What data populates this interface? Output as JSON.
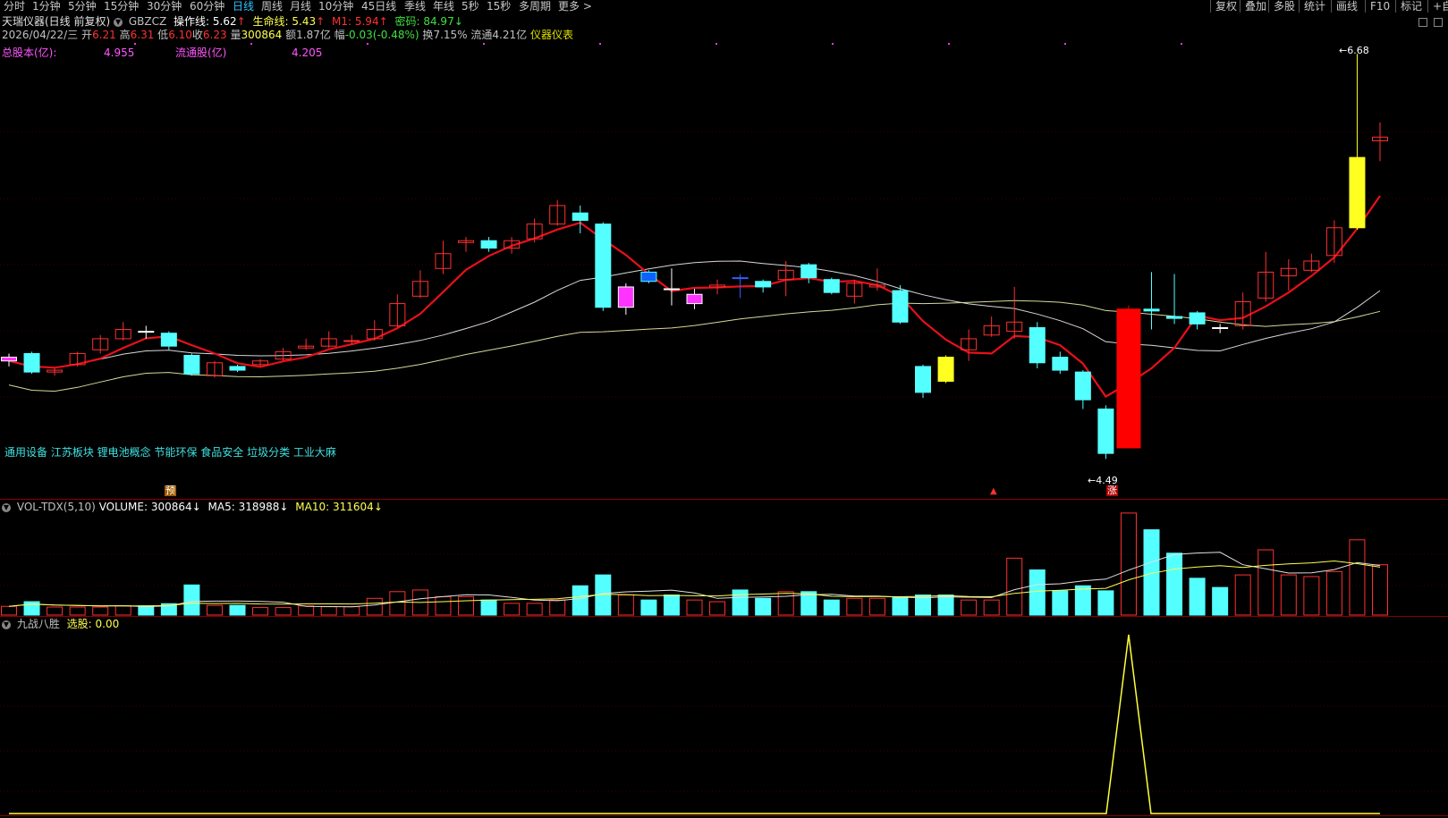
{
  "toolbar": {
    "periods": [
      "分时",
      "1分钟",
      "5分钟",
      "15分钟",
      "30分钟",
      "60分钟",
      "日线",
      "周线",
      "月线",
      "10分钟",
      "45日线",
      "季线",
      "年线",
      "5秒",
      "15秒",
      "多周期",
      "更多 >"
    ],
    "active": "日线",
    "right": [
      "复权",
      "叠加",
      "多股",
      "统计",
      "画线",
      "F10",
      "标记",
      "+自"
    ]
  },
  "header": {
    "name": "天瑞仪器(日线 前复权)",
    "indicator": "GBZCZ",
    "czx_label": "操作线:",
    "czx_value": "5.62",
    "smx_label": "生命线:",
    "smx_value": "5.43",
    "m1_label": "M1:",
    "m1_value": "5.94",
    "mm_label": "密码:",
    "mm_value": "84.97"
  },
  "quote": {
    "date": "2026/04/22/三",
    "open_label": "开",
    "open": "6.21",
    "high_label": "高",
    "high": "6.31",
    "low_label": "低",
    "low": "6.10",
    "close_label": "收",
    "close": "6.23",
    "vol_label": "量",
    "vol": "300864",
    "amt_label": "额",
    "amt": "1.87亿",
    "chg_label": "幅",
    "chg": "-0.03(-0.48%)",
    "turn_label": "换",
    "turn": "7.15%",
    "float_label": "流通",
    "float": "4.21亿",
    "industry": "仪器仪表"
  },
  "shares": {
    "total_label": "总股本(亿)",
    "total": "4.955",
    "float_label": "流通股(亿)",
    "float": "4.205"
  },
  "concepts": "通用设备 江苏板块 锂电池概念 节能环保 食品安全 垃圾分类 工业大麻",
  "markers": {
    "yu": "预",
    "zhang": "涨"
  },
  "price_labels": {
    "high": "6.68",
    "low": "4.49"
  },
  "volume_panel": {
    "name": "VOL-TDX(5,10)",
    "volume_label": "VOLUME:",
    "volume": "300864",
    "ma5_label": "MA5:",
    "ma5": "318988",
    "ma10_label": "MA10:",
    "ma10": "311604"
  },
  "signal_panel": {
    "name": "九战八胜",
    "label": "选股:",
    "value": "0.00"
  },
  "colors": {
    "up": "#ff3030",
    "down": "#54ffff",
    "red_line": "#e8101a",
    "white_line": "#d8d8d8",
    "yellow_line": "#d8d89a",
    "signal": "#ffff3a",
    "purple": "#ff33ff"
  },
  "chart_data": {
    "type": "candlestick",
    "candles": [
      {
        "o": 5.04,
        "c": 5.02,
        "h": 5.06,
        "l": 4.99,
        "dir": "flat-m"
      },
      {
        "o": 5.06,
        "c": 4.96,
        "h": 5.07,
        "l": 4.95,
        "dir": "down"
      },
      {
        "o": 4.96,
        "c": 4.97,
        "h": 4.98,
        "l": 4.94,
        "dir": "up"
      },
      {
        "o": 5.0,
        "c": 5.06,
        "h": 5.07,
        "l": 4.99,
        "dir": "up"
      },
      {
        "o": 5.08,
        "c": 5.14,
        "h": 5.16,
        "l": 5.06,
        "dir": "up"
      },
      {
        "o": 5.14,
        "c": 5.19,
        "h": 5.23,
        "l": 5.13,
        "dir": "up"
      },
      {
        "o": 5.18,
        "c": 5.18,
        "h": 5.21,
        "l": 5.14,
        "dir": "flat"
      },
      {
        "o": 5.17,
        "c": 5.1,
        "h": 5.18,
        "l": 5.08,
        "dir": "down"
      },
      {
        "o": 5.05,
        "c": 4.95,
        "h": 5.06,
        "l": 4.94,
        "dir": "down"
      },
      {
        "o": 4.94,
        "c": 5.01,
        "h": 5.02,
        "l": 4.93,
        "dir": "up"
      },
      {
        "o": 4.99,
        "c": 4.97,
        "h": 5.0,
        "l": 4.96,
        "dir": "down"
      },
      {
        "o": 5.0,
        "c": 5.02,
        "h": 5.03,
        "l": 4.99,
        "dir": "up"
      },
      {
        "o": 5.03,
        "c": 5.07,
        "h": 5.09,
        "l": 5.02,
        "dir": "up"
      },
      {
        "o": 5.09,
        "c": 5.1,
        "h": 5.14,
        "l": 5.08,
        "dir": "up"
      },
      {
        "o": 5.1,
        "c": 5.14,
        "h": 5.18,
        "l": 5.09,
        "dir": "up"
      },
      {
        "o": 5.13,
        "c": 5.13,
        "h": 5.16,
        "l": 5.11,
        "dir": "up"
      },
      {
        "o": 5.14,
        "c": 5.19,
        "h": 5.24,
        "l": 5.13,
        "dir": "up"
      },
      {
        "o": 5.21,
        "c": 5.33,
        "h": 5.38,
        "l": 5.2,
        "dir": "up"
      },
      {
        "o": 5.37,
        "c": 5.45,
        "h": 5.51,
        "l": 5.36,
        "dir": "up"
      },
      {
        "o": 5.52,
        "c": 5.6,
        "h": 5.67,
        "l": 5.49,
        "dir": "up"
      },
      {
        "o": 5.66,
        "c": 5.67,
        "h": 5.69,
        "l": 5.61,
        "dir": "up"
      },
      {
        "o": 5.67,
        "c": 5.63,
        "h": 5.69,
        "l": 5.61,
        "dir": "down"
      },
      {
        "o": 5.63,
        "c": 5.67,
        "h": 5.69,
        "l": 5.6,
        "dir": "up"
      },
      {
        "o": 5.68,
        "c": 5.76,
        "h": 5.79,
        "l": 5.66,
        "dir": "up"
      },
      {
        "o": 5.76,
        "c": 5.86,
        "h": 5.89,
        "l": 5.75,
        "dir": "up"
      },
      {
        "o": 5.82,
        "c": 5.78,
        "h": 5.86,
        "l": 5.71,
        "dir": "down"
      },
      {
        "o": 5.76,
        "c": 5.31,
        "h": 5.77,
        "l": 5.29,
        "dir": "down"
      },
      {
        "o": 5.31,
        "c": 5.42,
        "h": 5.44,
        "l": 5.27,
        "dir": "up-m"
      },
      {
        "o": 5.5,
        "c": 5.45,
        "h": 5.51,
        "l": 5.44,
        "dir": "down-b"
      },
      {
        "o": 5.41,
        "c": 5.41,
        "h": 5.52,
        "l": 5.32,
        "dir": "flat-w"
      },
      {
        "o": 5.33,
        "c": 5.38,
        "h": 5.41,
        "l": 5.3,
        "dir": "up-m"
      },
      {
        "o": 5.42,
        "c": 5.43,
        "h": 5.46,
        "l": 5.38,
        "dir": "up"
      },
      {
        "o": 5.47,
        "c": 5.47,
        "h": 5.49,
        "l": 5.36,
        "dir": "flat-b"
      },
      {
        "o": 5.45,
        "c": 5.42,
        "h": 5.46,
        "l": 5.39,
        "dir": "down"
      },
      {
        "o": 5.46,
        "c": 5.51,
        "h": 5.56,
        "l": 5.37,
        "dir": "up"
      },
      {
        "o": 5.54,
        "c": 5.47,
        "h": 5.55,
        "l": 5.44,
        "dir": "down"
      },
      {
        "o": 5.46,
        "c": 5.39,
        "h": 5.47,
        "l": 5.38,
        "dir": "down"
      },
      {
        "o": 5.37,
        "c": 5.44,
        "h": 5.46,
        "l": 5.33,
        "dir": "up"
      },
      {
        "o": 5.43,
        "c": 5.42,
        "h": 5.52,
        "l": 5.4,
        "dir": "up"
      },
      {
        "o": 5.4,
        "c": 5.23,
        "h": 5.43,
        "l": 5.22,
        "dir": "down"
      },
      {
        "o": 4.99,
        "c": 4.85,
        "h": 5.0,
        "l": 4.82,
        "dir": "down"
      },
      {
        "o": 4.91,
        "c": 5.04,
        "h": 5.05,
        "l": 4.9,
        "dir": "yellow"
      },
      {
        "o": 5.08,
        "c": 5.14,
        "h": 5.19,
        "l": 5.02,
        "dir": "up"
      },
      {
        "o": 5.16,
        "c": 5.21,
        "h": 5.26,
        "l": 5.15,
        "dir": "up"
      },
      {
        "o": 5.18,
        "c": 5.23,
        "h": 5.42,
        "l": 5.14,
        "dir": "up"
      },
      {
        "o": 5.2,
        "c": 5.01,
        "h": 5.23,
        "l": 4.98,
        "dir": "down"
      },
      {
        "o": 5.04,
        "c": 4.97,
        "h": 5.07,
        "l": 4.95,
        "dir": "down"
      },
      {
        "o": 4.96,
        "c": 4.81,
        "h": 4.97,
        "l": 4.76,
        "dir": "down"
      },
      {
        "o": 4.76,
        "c": 4.52,
        "h": 4.78,
        "l": 4.49,
        "dir": "down"
      },
      {
        "o": 4.55,
        "c": 5.3,
        "h": 5.32,
        "l": 4.55,
        "dir": "up-fill"
      },
      {
        "o": 5.3,
        "c": 5.29,
        "h": 5.5,
        "l": 5.19,
        "dir": "down"
      },
      {
        "o": 5.26,
        "c": 5.25,
        "h": 5.49,
        "l": 5.22,
        "dir": "down"
      },
      {
        "o": 5.28,
        "c": 5.22,
        "h": 5.29,
        "l": 5.19,
        "dir": "down"
      },
      {
        "o": 5.2,
        "c": 5.2,
        "h": 5.22,
        "l": 5.17,
        "dir": "flat-w"
      },
      {
        "o": 5.21,
        "c": 5.34,
        "h": 5.39,
        "l": 5.19,
        "dir": "up"
      },
      {
        "o": 5.36,
        "c": 5.5,
        "h": 5.61,
        "l": 5.34,
        "dir": "up"
      },
      {
        "o": 5.48,
        "c": 5.52,
        "h": 5.57,
        "l": 5.4,
        "dir": "up"
      },
      {
        "o": 5.51,
        "c": 5.56,
        "h": 5.6,
        "l": 5.5,
        "dir": "up"
      },
      {
        "o": 5.59,
        "c": 5.74,
        "h": 5.78,
        "l": 5.55,
        "dir": "up"
      },
      {
        "o": 5.74,
        "c": 6.12,
        "h": 6.68,
        "l": 5.73,
        "dir": "yellow"
      },
      {
        "o": 6.21,
        "c": 6.23,
        "h": 6.31,
        "l": 6.1,
        "dir": "up"
      }
    ],
    "volumes": [
      {
        "v": 52000,
        "up": true
      },
      {
        "v": 80000,
        "up": false
      },
      {
        "v": 48000,
        "up": true
      },
      {
        "v": 48000,
        "up": true
      },
      {
        "v": 48000,
        "up": true
      },
      {
        "v": 55000,
        "up": true
      },
      {
        "v": 55000,
        "up": false
      },
      {
        "v": 68000,
        "up": false
      },
      {
        "v": 180000,
        "up": false
      },
      {
        "v": 58000,
        "up": true
      },
      {
        "v": 58000,
        "up": false
      },
      {
        "v": 45000,
        "up": true
      },
      {
        "v": 45000,
        "up": true
      },
      {
        "v": 55000,
        "up": true
      },
      {
        "v": 50000,
        "up": true
      },
      {
        "v": 50000,
        "up": true
      },
      {
        "v": 100000,
        "up": true
      },
      {
        "v": 140000,
        "up": true
      },
      {
        "v": 150000,
        "up": true
      },
      {
        "v": 110000,
        "up": true
      },
      {
        "v": 110000,
        "up": true
      },
      {
        "v": 90000,
        "up": false
      },
      {
        "v": 70000,
        "up": true
      },
      {
        "v": 70000,
        "up": true
      },
      {
        "v": 90000,
        "up": true
      },
      {
        "v": 175000,
        "up": false
      },
      {
        "v": 240000,
        "up": false
      },
      {
        "v": 120000,
        "up": true
      },
      {
        "v": 90000,
        "up": false
      },
      {
        "v": 120000,
        "up": false
      },
      {
        "v": 90000,
        "up": true
      },
      {
        "v": 80000,
        "up": true
      },
      {
        "v": 150000,
        "up": false
      },
      {
        "v": 100000,
        "up": false
      },
      {
        "v": 140000,
        "up": true
      },
      {
        "v": 140000,
        "up": false
      },
      {
        "v": 90000,
        "up": false
      },
      {
        "v": 100000,
        "up": true
      },
      {
        "v": 100000,
        "up": true
      },
      {
        "v": 105000,
        "up": false
      },
      {
        "v": 120000,
        "up": false
      },
      {
        "v": 120000,
        "up": false
      },
      {
        "v": 90000,
        "up": true
      },
      {
        "v": 90000,
        "up": true
      },
      {
        "v": 340000,
        "up": true
      },
      {
        "v": 270000,
        "up": false
      },
      {
        "v": 145000,
        "up": false
      },
      {
        "v": 175000,
        "up": false
      },
      {
        "v": 145000,
        "up": false
      },
      {
        "v": 610000,
        "up": true
      },
      {
        "v": 510000,
        "up": false
      },
      {
        "v": 370000,
        "up": false
      },
      {
        "v": 220000,
        "up": false
      },
      {
        "v": 165000,
        "up": false
      },
      {
        "v": 240000,
        "up": true
      },
      {
        "v": 390000,
        "up": true
      },
      {
        "v": 240000,
        "up": true
      },
      {
        "v": 230000,
        "up": true
      },
      {
        "v": 260000,
        "up": true
      },
      {
        "v": 450000,
        "up": true
      },
      {
        "v": 300864,
        "up": true
      }
    ],
    "signal": {
      "peak_index": 49,
      "value_peak": 1,
      "value_base": 0
    },
    "y_range": [
      4.4,
      6.72
    ],
    "vol_max": 620000
  }
}
